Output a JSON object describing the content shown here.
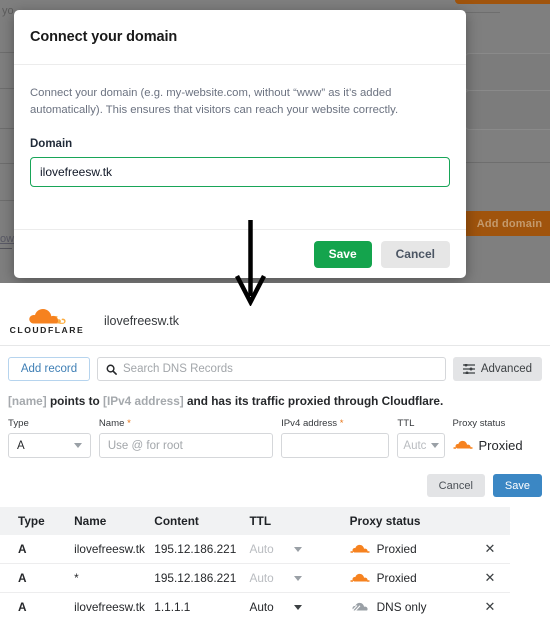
{
  "top_screenshot": {
    "background": {
      "partial_text_top_left": "yo",
      "partial_link_bottom_left": "ow",
      "add_domain_button": "Add domain",
      "overlay_color": "#7f7f7f",
      "button_color": "#a0540d"
    },
    "modal": {
      "title": "Connect your domain",
      "description": "Connect your domain (e.g. my-website.com, without “www” as it’s added automatically). This ensures that visitors can reach your website correctly.",
      "field_label": "Domain",
      "domain_value": "ilovefreesw.tk",
      "domain_placeholder": "",
      "save_label": "Save",
      "cancel_label": "Cancel",
      "save_color": "#14a44d",
      "input_border_color": "#18a558"
    }
  },
  "arrow": {
    "name": "down-arrow-annotation",
    "color": "#000000"
  },
  "bottom_screenshot": {
    "header": {
      "brand": "CLOUDFLARE",
      "zone": "ilovefreesw.tk"
    },
    "toolbar": {
      "add_record_label": "Add record",
      "search_placeholder": "Search DNS Records",
      "search_value": "",
      "advanced_label": "Advanced"
    },
    "hint": {
      "part1": "[name]",
      "part2": " points to ",
      "part3": "[IPv4 address]",
      "part4": " and has its traffic proxied through Cloudflare."
    },
    "form": {
      "type_label": "Type",
      "type_value": "A",
      "name_label": "Name",
      "name_required": "*",
      "name_placeholder": "Use @ for root",
      "name_value": "",
      "ipv4_label": "IPv4 address",
      "ipv4_required": "*",
      "ipv4_value": "",
      "ttl_label": "TTL",
      "ttl_value": "Autc",
      "proxy_label": "Proxy status",
      "proxy_value": "Proxied",
      "cancel_label": "Cancel",
      "save_label": "Save",
      "save_color": "#3b87c4"
    },
    "table": {
      "columns": [
        "Type",
        "Name",
        "Content",
        "TTL",
        "Proxy status",
        ""
      ],
      "rows": [
        {
          "type": "A",
          "name": "ilovefreesw.tk",
          "content": "195.12.186.221",
          "ttl": "Auto",
          "ttl_muted": true,
          "proxy": "Proxied",
          "proxied": true,
          "delete": "✕"
        },
        {
          "type": "A",
          "name": "*",
          "content": "195.12.186.221",
          "ttl": "Auto",
          "ttl_muted": true,
          "proxy": "Proxied",
          "proxied": true,
          "delete": "✕"
        },
        {
          "type": "A",
          "name": "ilovefreesw.tk",
          "content": "1.1.1.1",
          "ttl": "Auto",
          "ttl_muted": false,
          "proxy": "DNS only",
          "proxied": false,
          "delete": "✕"
        }
      ]
    },
    "colors": {
      "cloudflare_orange": "#f6821f",
      "dns_only_grey": "#9aa0a6"
    }
  }
}
